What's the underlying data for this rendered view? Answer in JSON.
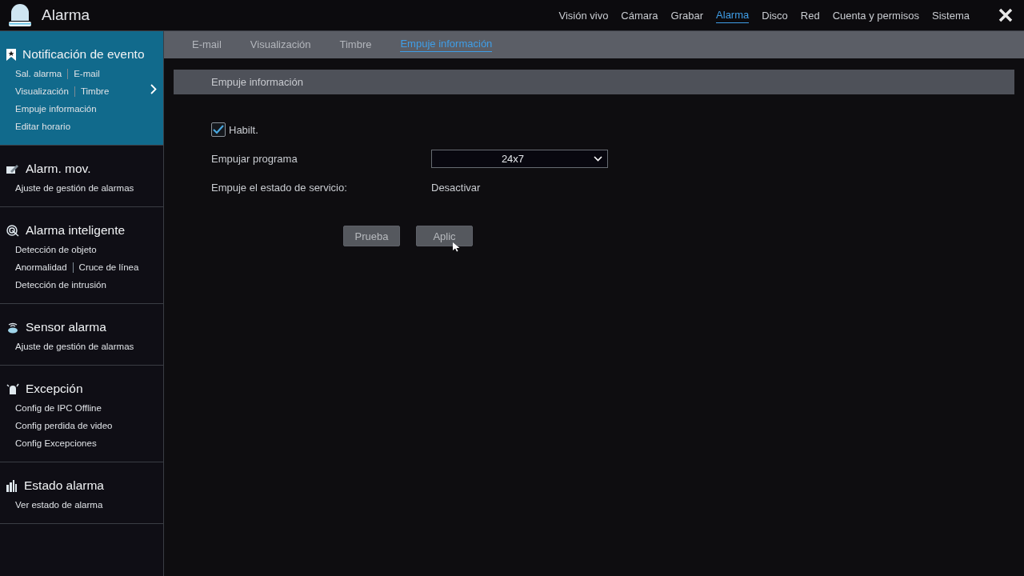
{
  "app": {
    "title": "Alarma"
  },
  "nav": [
    {
      "label": "Visión vivo",
      "selected": false
    },
    {
      "label": "Cámara",
      "selected": false
    },
    {
      "label": "Grabar",
      "selected": false
    },
    {
      "label": "Alarma",
      "selected": true
    },
    {
      "label": "Disco",
      "selected": false
    },
    {
      "label": "Red",
      "selected": false
    },
    {
      "label": "Cuenta y permisos",
      "selected": false
    },
    {
      "label": "Sistema",
      "selected": false
    }
  ],
  "sidebar": [
    {
      "kind": "bookmark",
      "title": "Notificación de evento",
      "selected": true,
      "lines": [
        [
          "Sal. alarma",
          "E-mail"
        ],
        [
          "Visualización",
          "Timbre"
        ],
        [
          "Empuje información"
        ],
        [
          "Editar horario"
        ]
      ]
    },
    {
      "kind": "motion",
      "title": "Alarm. mov.",
      "selected": false,
      "lines": [
        [
          "Ajuste de gestión de alarmas"
        ]
      ]
    },
    {
      "kind": "target",
      "title": "Alarma inteligente",
      "selected": false,
      "lines": [
        [
          "Detección de objeto"
        ],
        [
          "Anormalidad",
          "Cruce de línea"
        ],
        [
          "Detección de intrusión"
        ]
      ]
    },
    {
      "kind": "sensor",
      "title": "Sensor alarma",
      "selected": false,
      "lines": [
        [
          "Ajuste de gestión de alarmas"
        ]
      ]
    },
    {
      "kind": "siren",
      "title": "Excepción",
      "selected": false,
      "lines": [
        [
          "Config de IPC Offline"
        ],
        [
          "Config perdida de video"
        ],
        [
          "Config Excepciones"
        ]
      ]
    },
    {
      "kind": "bars",
      "title": "Estado alarma",
      "selected": false,
      "lines": [
        [
          "Ver estado de alarma"
        ]
      ]
    }
  ],
  "tabs": [
    {
      "label": "E-mail",
      "selected": false
    },
    {
      "label": "Visualización",
      "selected": false
    },
    {
      "label": "Timbre",
      "selected": false
    },
    {
      "label": "Empuje información",
      "selected": true
    }
  ],
  "section": {
    "title": "Empuje información"
  },
  "form": {
    "enable": {
      "label": "Habilt.",
      "checked": true
    },
    "schedule": {
      "label": "Empujar programa",
      "value": "24x7"
    },
    "status": {
      "label": "Empuje el estado de servicio:",
      "value": "Desactivar"
    }
  },
  "buttons": [
    "Prueba",
    "Aplic"
  ]
}
